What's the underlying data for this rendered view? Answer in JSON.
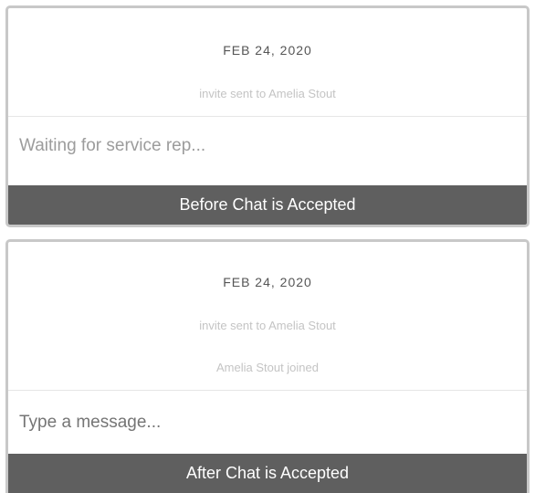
{
  "before": {
    "date": "FEB 24, 2020",
    "events": [
      "invite sent to Amelia Stout"
    ],
    "composer_placeholder": "Waiting for service rep...",
    "caption": "Before Chat is Accepted"
  },
  "after": {
    "date": "FEB 24, 2020",
    "events": [
      "invite sent to Amelia Stout",
      "Amelia Stout joined"
    ],
    "composer_placeholder": "Type a message...",
    "caption": "After Chat is Accepted"
  },
  "colors": {
    "caption_bg": "#5f5f5f",
    "panel_border": "#c8c8c8",
    "event_text": "#c4c4c4",
    "placeholder_text": "#9c9c9c"
  }
}
